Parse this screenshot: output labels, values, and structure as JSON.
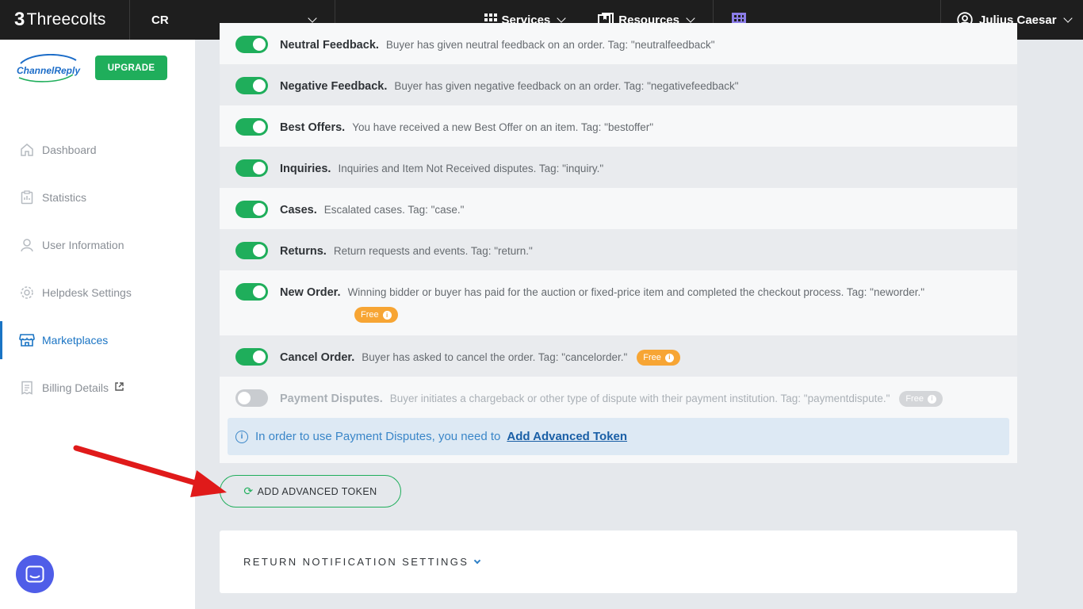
{
  "topbar": {
    "brand": "Threecolts",
    "account": "CR",
    "services": "Services",
    "resources": "Resources",
    "user": "Julius Caesar"
  },
  "sidebar": {
    "logo_text": "ChannelReply",
    "upgrade": "UPGRADE",
    "items": [
      {
        "label": "Dashboard",
        "icon": "home-icon"
      },
      {
        "label": "Statistics",
        "icon": "clipboard-icon"
      },
      {
        "label": "User Information",
        "icon": "user-icon"
      },
      {
        "label": "Helpdesk Settings",
        "icon": "gear-icon"
      },
      {
        "label": "Marketplaces",
        "icon": "store-icon",
        "active": true
      },
      {
        "label": "Billing Details",
        "icon": "receipt-icon"
      }
    ]
  },
  "notifications": [
    {
      "title": "Neutral Feedback.",
      "desc": "Buyer has given neutral feedback on an order. Tag: \"neutralfeedback\"",
      "on": true
    },
    {
      "title": "Negative Feedback.",
      "desc": "Buyer has given negative feedback on an order. Tag: \"negativefeedback\"",
      "on": true
    },
    {
      "title": "Best Offers.",
      "desc": "You have received a new Best Offer on an item. Tag: \"bestoffer\"",
      "on": true
    },
    {
      "title": "Inquiries.",
      "desc": "Inquiries and Item Not Received disputes. Tag: \"inquiry.\"",
      "on": true
    },
    {
      "title": "Cases.",
      "desc": "Escalated cases. Tag: \"case.\"",
      "on": true
    },
    {
      "title": "Returns.",
      "desc": "Return requests and events. Tag: \"return.\"",
      "on": true
    },
    {
      "title": "New Order.",
      "desc": "Winning bidder or buyer has paid for the auction or fixed-price item and completed the checkout process. Tag: \"neworder.\"",
      "on": true,
      "badge": "Free"
    },
    {
      "title": "Cancel Order.",
      "desc": "Buyer has asked to cancel the order. Tag: \"cancelorder.\"",
      "on": true,
      "badge": "Free"
    },
    {
      "title": "Payment Disputes.",
      "desc": "Buyer initiates a chargeback or other type of dispute with their payment institution. Tag: \"paymentdispute.\"",
      "on": false,
      "badge": "Free"
    }
  ],
  "info": {
    "text": "In order to use Payment Disputes, you need to",
    "link": "Add Advanced Token"
  },
  "add_token_button": "ADD ADVANCED TOKEN",
  "return_section": "RETURN NOTIFICATION SETTINGS",
  "colors": {
    "accent_green": "#1fae5b",
    "badge_orange": "#f7a534",
    "link_blue": "#1a74c4",
    "arrow_red": "#e01a1a"
  }
}
